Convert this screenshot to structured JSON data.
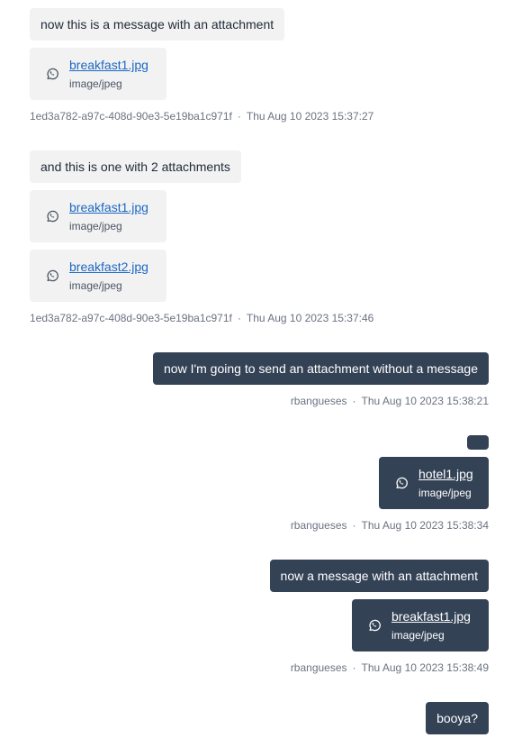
{
  "colors": {
    "incoming_bubble": "#f2f2f3",
    "outgoing_bubble": "#344256",
    "link": "#1d68c2",
    "meta_text": "#6b7280"
  },
  "icons": {
    "attachment": "whatsapp-icon"
  },
  "separator": "·",
  "messages": [
    {
      "direction": "incoming",
      "text": "now this is a message with an attachment",
      "attachments": [
        {
          "name": "breakfast1.jpg",
          "type": "image/jpeg"
        }
      ],
      "sender": "1ed3a782-a97c-408d-90e3-5e19ba1c971f",
      "timestamp": "Thu Aug 10 2023 15:37:27"
    },
    {
      "direction": "incoming",
      "text": "and this is one with 2 attachments",
      "attachments": [
        {
          "name": "breakfast1.jpg",
          "type": "image/jpeg"
        },
        {
          "name": "breakfast2.jpg",
          "type": "image/jpeg"
        }
      ],
      "sender": "1ed3a782-a97c-408d-90e3-5e19ba1c971f",
      "timestamp": "Thu Aug 10 2023 15:37:46"
    },
    {
      "direction": "outgoing",
      "text": "now I'm going to send an attachment without a message",
      "attachments": [],
      "sender": "rbangueses",
      "timestamp": "Thu Aug 10 2023 15:38:21"
    },
    {
      "direction": "outgoing",
      "text": "",
      "attachments": [
        {
          "name": "hotel1.jpg",
          "type": "image/jpeg"
        }
      ],
      "sender": "rbangueses",
      "timestamp": "Thu Aug 10 2023 15:38:34"
    },
    {
      "direction": "outgoing",
      "text": "now a message with an attachment",
      "attachments": [
        {
          "name": "breakfast1.jpg",
          "type": "image/jpeg"
        }
      ],
      "sender": "rbangueses",
      "timestamp": "Thu Aug 10 2023 15:38:49"
    },
    {
      "direction": "outgoing",
      "text": "booya?",
      "attachments": [],
      "sender": "",
      "timestamp": ""
    }
  ]
}
